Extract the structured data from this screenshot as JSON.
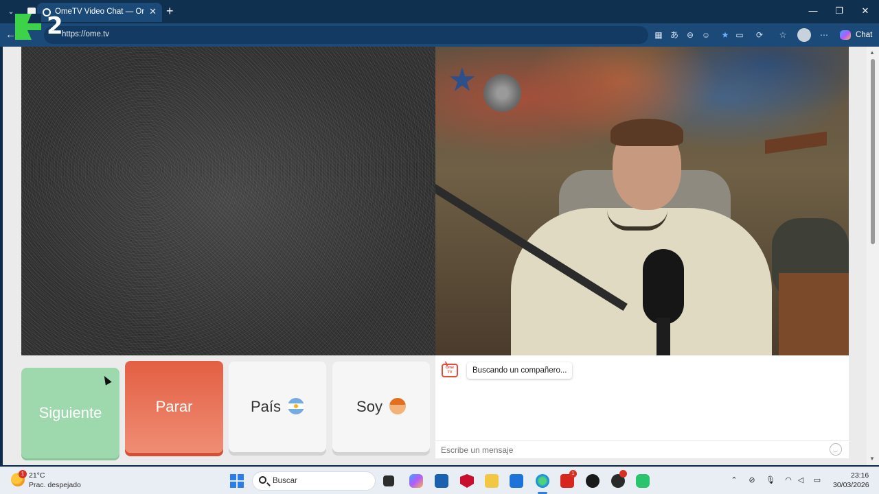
{
  "browser": {
    "tab_title": "OmeTV Video Chat — Omegl",
    "url": "https://ome.tv",
    "new_tab_symbol": "+",
    "tab_list_symbol": "⌄",
    "close_tab_symbol": "✕",
    "chat_label": "Chat",
    "window_controls": {
      "minimize": "—",
      "maximize": "❐",
      "close": "✕"
    },
    "toolbar_icons": [
      "apps-icon",
      "translate-icon",
      "zoom-icon",
      "reading-mode-icon",
      "favorite-star-icon",
      "camera-icon",
      "extensions-icon",
      "favorites-icon",
      "profile-icon",
      "more-icon"
    ]
  },
  "overlay": {
    "channel_logo_number": "2"
  },
  "controls": {
    "next_label": "Siguiente",
    "stop_label": "Parar",
    "country_label": "País",
    "country_flag": "argentina-flag-icon",
    "soy_label": "Soy",
    "soy_avatar": "boy-avatar-icon"
  },
  "chat": {
    "logo_text": "Ome TV",
    "status_message": "Buscando un compañero...",
    "input_placeholder": "Escribe un mensaje"
  },
  "taskbar": {
    "weather_temp": "21°C",
    "weather_condition": "Prac. despejado",
    "weather_badge": "1",
    "search_label": "Buscar",
    "mail_badge": "1",
    "time": "23:16",
    "date": "30/03/2026"
  },
  "colors": {
    "next_button": "#9ed8ad",
    "stop_button": "#e35f43",
    "neutral_button": "#f6f6f6",
    "browser_frame": "#1c4a78",
    "taskbar": "#e9eef5"
  }
}
